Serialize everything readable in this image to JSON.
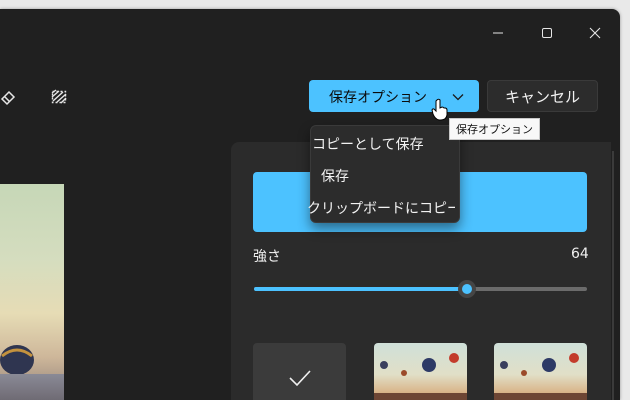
{
  "toolbar": {
    "save_options_label": "保存オプション",
    "cancel_label": "キャンセル",
    "icons": [
      "eraser-icon",
      "pattern-icon",
      "chevron-down-icon"
    ]
  },
  "dropdown": {
    "items": [
      "コピーとして保存",
      "保存",
      "クリップボードにコピー"
    ]
  },
  "tooltip": {
    "text": "保存オプション"
  },
  "panel": {
    "strength_label": "強さ",
    "strength_value": "64",
    "strength_fraction": 0.64,
    "accent_color": "#4cc2ff"
  },
  "window_controls": [
    "minimize-icon",
    "maximize-icon",
    "close-icon"
  ]
}
